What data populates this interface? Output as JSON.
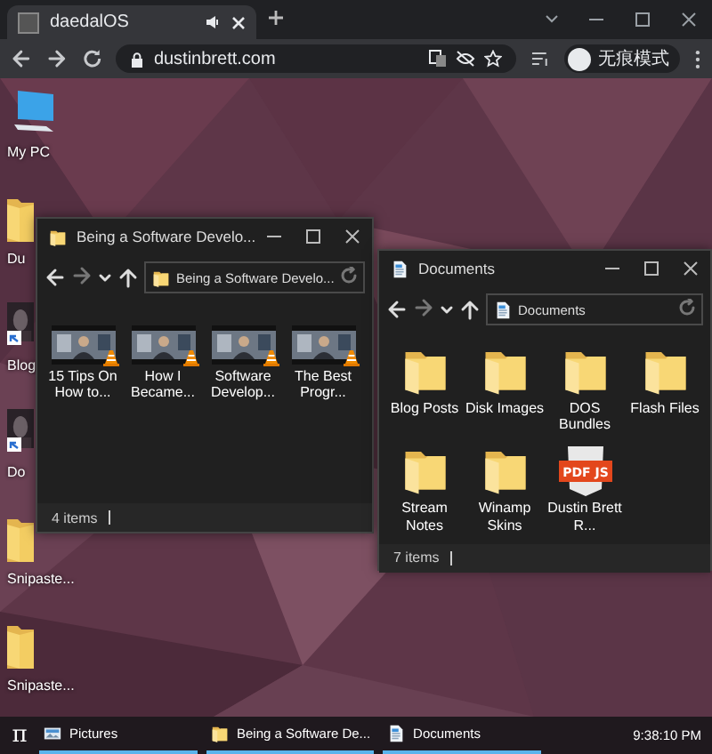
{
  "browser": {
    "tab": {
      "title": "daedalOS"
    },
    "address": "dustinbrett.com",
    "profile": "无痕模式"
  },
  "desktop": {
    "icons": [
      {
        "kind": "computer",
        "label": "My PC"
      },
      {
        "kind": "folder",
        "label": "Du"
      },
      {
        "kind": "shortcut",
        "label": "Blog"
      },
      {
        "kind": "shortcut",
        "label": "Do"
      },
      {
        "kind": "folder",
        "label": "Snipaste..."
      },
      {
        "kind": "folder",
        "label": "Snipaste..."
      }
    ]
  },
  "windows": [
    {
      "kind": "folder",
      "title": "Being a Software Develo...",
      "address": "Being a Software Develo...",
      "status": "4 items",
      "items": [
        {
          "kind": "video",
          "label": "15 Tips On How to..."
        },
        {
          "kind": "video",
          "label": "How I Became..."
        },
        {
          "kind": "video",
          "label": "Software Develop..."
        },
        {
          "kind": "video",
          "label": "The Best Progr..."
        }
      ]
    },
    {
      "kind": "document",
      "title": "Documents",
      "address": "Documents",
      "status": "7 items",
      "items": [
        {
          "kind": "folder",
          "label": "Blog Posts"
        },
        {
          "kind": "folder",
          "label": "Disk Images"
        },
        {
          "kind": "folder",
          "label": "DOS Bundles"
        },
        {
          "kind": "folder",
          "label": "Flash Files"
        },
        {
          "kind": "folder",
          "label": "Stream Notes"
        },
        {
          "kind": "folder",
          "label": "Winamp Skins"
        },
        {
          "kind": "pdf",
          "label": "Dustin Brett R...",
          "icon_text": "PDF JS"
        }
      ]
    }
  ],
  "taskbar": {
    "start": "π",
    "items": [
      {
        "kind": "picture",
        "label": "Pictures"
      },
      {
        "kind": "folder",
        "label": "Being a Software De..."
      },
      {
        "kind": "document",
        "label": "Documents"
      }
    ],
    "clock": "9:38:10 PM"
  }
}
